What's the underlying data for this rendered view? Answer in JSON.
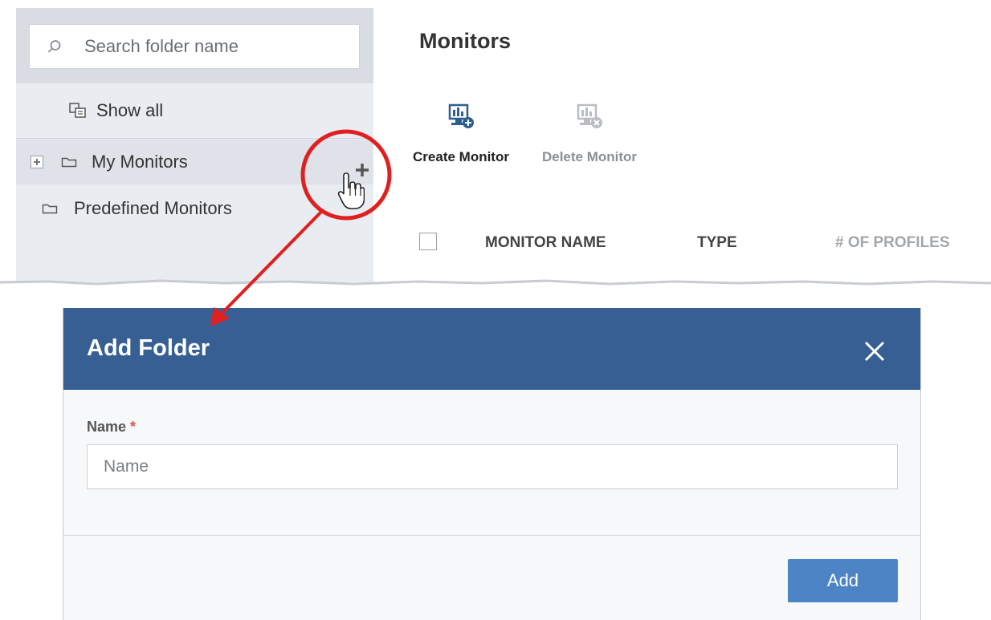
{
  "sidebar": {
    "search": {
      "placeholder": "Search folder name"
    },
    "show_all_label": "Show all",
    "tree": [
      {
        "label": "My Monitors"
      },
      {
        "label": "Predefined Monitors"
      }
    ]
  },
  "main": {
    "title": "Monitors",
    "toolbar": {
      "create_label": "Create Monitor",
      "delete_label": "Delete Monitor"
    },
    "columns": [
      "MONITOR NAME",
      "TYPE",
      "# OF PROFILES"
    ]
  },
  "dialog": {
    "title": "Add Folder",
    "name_label": "Name",
    "required_mark": "*",
    "name_placeholder": "Name",
    "add_label": "Add"
  },
  "colors": {
    "dialog_header": "#375f93",
    "add_button": "#4c84c6",
    "annotation": "#e02020"
  }
}
